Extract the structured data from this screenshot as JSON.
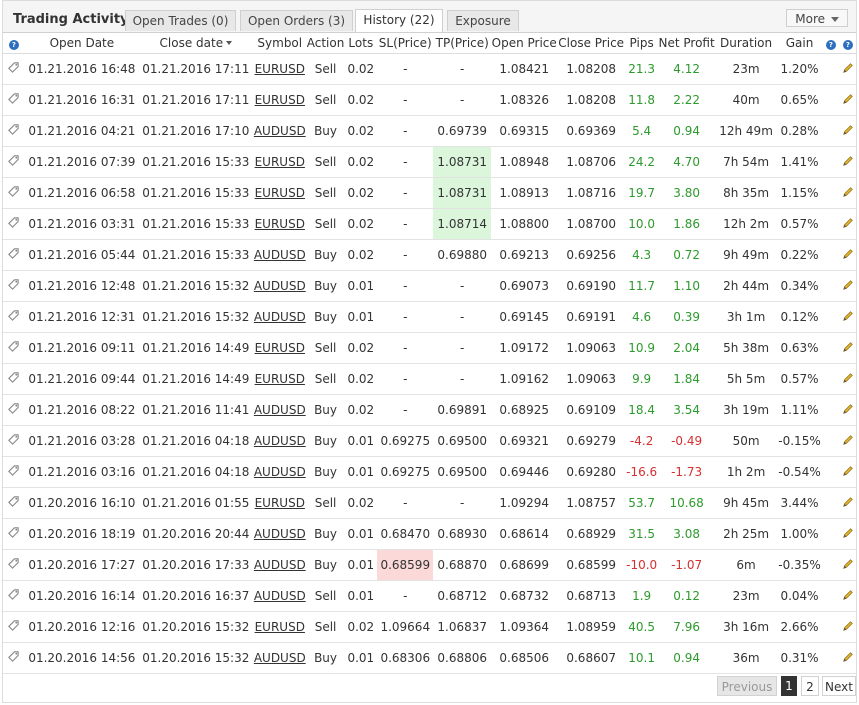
{
  "header": {
    "title": "Trading Activity",
    "tabs": [
      {
        "label": "Open Trades (0)"
      },
      {
        "label": "Open Orders (3)"
      },
      {
        "label": "History (22)"
      },
      {
        "label": "Exposure"
      }
    ],
    "more_label": "More"
  },
  "columns": [
    "Open Date",
    "Close date",
    "Symbol",
    "Action",
    "Lots",
    "SL(Price)",
    "TP(Price)",
    "Open Price",
    "Close Price",
    "Pips",
    "Net Profit",
    "Duration",
    "Gain"
  ],
  "colors": {
    "positive": "#2c9a2c",
    "negative": "#d63030",
    "tp_highlight": "#dcf6dc",
    "sl_highlight": "#fbd9d9",
    "help_icon": "#2d6fbf"
  },
  "rows": [
    {
      "open": "01.21.2016 16:48",
      "close": "01.21.2016 17:11",
      "symbol": "EURUSD",
      "action": "Sell",
      "lots": "0.02",
      "sl": "-",
      "tp": "-",
      "open_price": "1.08421",
      "close_price": "1.08208",
      "pips": "21.3",
      "profit": "4.12",
      "duration": "23m",
      "gain": "1.20%",
      "sign": "pos",
      "hl": ""
    },
    {
      "open": "01.21.2016 16:31",
      "close": "01.21.2016 17:11",
      "symbol": "EURUSD",
      "action": "Sell",
      "lots": "0.02",
      "sl": "-",
      "tp": "-",
      "open_price": "1.08326",
      "close_price": "1.08208",
      "pips": "11.8",
      "profit": "2.22",
      "duration": "40m",
      "gain": "0.65%",
      "sign": "pos",
      "hl": ""
    },
    {
      "open": "01.21.2016 04:21",
      "close": "01.21.2016 17:10",
      "symbol": "AUDUSD",
      "action": "Buy",
      "lots": "0.02",
      "sl": "-",
      "tp": "0.69739",
      "open_price": "0.69315",
      "close_price": "0.69369",
      "pips": "5.4",
      "profit": "0.94",
      "duration": "12h 49m",
      "gain": "0.28%",
      "sign": "pos",
      "hl": ""
    },
    {
      "open": "01.21.2016 07:39",
      "close": "01.21.2016 15:33",
      "symbol": "EURUSD",
      "action": "Sell",
      "lots": "0.02",
      "sl": "-",
      "tp": "1.08731",
      "open_price": "1.08948",
      "close_price": "1.08706",
      "pips": "24.2",
      "profit": "4.70",
      "duration": "7h 54m",
      "gain": "1.41%",
      "sign": "pos",
      "hl": "tp"
    },
    {
      "open": "01.21.2016 06:58",
      "close": "01.21.2016 15:33",
      "symbol": "EURUSD",
      "action": "Sell",
      "lots": "0.02",
      "sl": "-",
      "tp": "1.08731",
      "open_price": "1.08913",
      "close_price": "1.08716",
      "pips": "19.7",
      "profit": "3.80",
      "duration": "8h 35m",
      "gain": "1.15%",
      "sign": "pos",
      "hl": "tp"
    },
    {
      "open": "01.21.2016 03:31",
      "close": "01.21.2016 15:33",
      "symbol": "EURUSD",
      "action": "Sell",
      "lots": "0.02",
      "sl": "-",
      "tp": "1.08714",
      "open_price": "1.08800",
      "close_price": "1.08700",
      "pips": "10.0",
      "profit": "1.86",
      "duration": "12h 2m",
      "gain": "0.57%",
      "sign": "pos",
      "hl": "tp"
    },
    {
      "open": "01.21.2016 05:44",
      "close": "01.21.2016 15:33",
      "symbol": "AUDUSD",
      "action": "Buy",
      "lots": "0.02",
      "sl": "-",
      "tp": "0.69880",
      "open_price": "0.69213",
      "close_price": "0.69256",
      "pips": "4.3",
      "profit": "0.72",
      "duration": "9h 49m",
      "gain": "0.22%",
      "sign": "pos",
      "hl": ""
    },
    {
      "open": "01.21.2016 12:48",
      "close": "01.21.2016 15:32",
      "symbol": "AUDUSD",
      "action": "Buy",
      "lots": "0.01",
      "sl": "-",
      "tp": "-",
      "open_price": "0.69073",
      "close_price": "0.69190",
      "pips": "11.7",
      "profit": "1.10",
      "duration": "2h 44m",
      "gain": "0.34%",
      "sign": "pos",
      "hl": ""
    },
    {
      "open": "01.21.2016 12:31",
      "close": "01.21.2016 15:32",
      "symbol": "AUDUSD",
      "action": "Buy",
      "lots": "0.01",
      "sl": "-",
      "tp": "-",
      "open_price": "0.69145",
      "close_price": "0.69191",
      "pips": "4.6",
      "profit": "0.39",
      "duration": "3h 1m",
      "gain": "0.12%",
      "sign": "pos",
      "hl": ""
    },
    {
      "open": "01.21.2016 09:11",
      "close": "01.21.2016 14:49",
      "symbol": "EURUSD",
      "action": "Sell",
      "lots": "0.02",
      "sl": "-",
      "tp": "-",
      "open_price": "1.09172",
      "close_price": "1.09063",
      "pips": "10.9",
      "profit": "2.04",
      "duration": "5h 38m",
      "gain": "0.63%",
      "sign": "pos",
      "hl": ""
    },
    {
      "open": "01.21.2016 09:44",
      "close": "01.21.2016 14:49",
      "symbol": "EURUSD",
      "action": "Sell",
      "lots": "0.02",
      "sl": "-",
      "tp": "-",
      "open_price": "1.09162",
      "close_price": "1.09063",
      "pips": "9.9",
      "profit": "1.84",
      "duration": "5h 5m",
      "gain": "0.57%",
      "sign": "pos",
      "hl": ""
    },
    {
      "open": "01.21.2016 08:22",
      "close": "01.21.2016 11:41",
      "symbol": "AUDUSD",
      "action": "Buy",
      "lots": "0.02",
      "sl": "-",
      "tp": "0.69891",
      "open_price": "0.68925",
      "close_price": "0.69109",
      "pips": "18.4",
      "profit": "3.54",
      "duration": "3h 19m",
      "gain": "1.11%",
      "sign": "pos",
      "hl": ""
    },
    {
      "open": "01.21.2016 03:28",
      "close": "01.21.2016 04:18",
      "symbol": "AUDUSD",
      "action": "Buy",
      "lots": "0.01",
      "sl": "0.69275",
      "tp": "0.69500",
      "open_price": "0.69321",
      "close_price": "0.69279",
      "pips": "-4.2",
      "profit": "-0.49",
      "duration": "50m",
      "gain": "-0.15%",
      "sign": "neg",
      "hl": ""
    },
    {
      "open": "01.21.2016 03:16",
      "close": "01.21.2016 04:18",
      "symbol": "AUDUSD",
      "action": "Buy",
      "lots": "0.01",
      "sl": "0.69275",
      "tp": "0.69500",
      "open_price": "0.69446",
      "close_price": "0.69280",
      "pips": "-16.6",
      "profit": "-1.73",
      "duration": "1h 2m",
      "gain": "-0.54%",
      "sign": "neg",
      "hl": ""
    },
    {
      "open": "01.20.2016 16:10",
      "close": "01.21.2016 01:55",
      "symbol": "EURUSD",
      "action": "Sell",
      "lots": "0.02",
      "sl": "-",
      "tp": "-",
      "open_price": "1.09294",
      "close_price": "1.08757",
      "pips": "53.7",
      "profit": "10.68",
      "duration": "9h 45m",
      "gain": "3.44%",
      "sign": "pos",
      "hl": ""
    },
    {
      "open": "01.20.2016 18:19",
      "close": "01.20.2016 20:44",
      "symbol": "AUDUSD",
      "action": "Buy",
      "lots": "0.01",
      "sl": "0.68470",
      "tp": "0.68930",
      "open_price": "0.68614",
      "close_price": "0.68929",
      "pips": "31.5",
      "profit": "3.08",
      "duration": "2h 25m",
      "gain": "1.00%",
      "sign": "pos",
      "hl": ""
    },
    {
      "open": "01.20.2016 17:27",
      "close": "01.20.2016 17:33",
      "symbol": "AUDUSD",
      "action": "Buy",
      "lots": "0.01",
      "sl": "0.68599",
      "tp": "0.68870",
      "open_price": "0.68699",
      "close_price": "0.68599",
      "pips": "-10.0",
      "profit": "-1.07",
      "duration": "6m",
      "gain": "-0.35%",
      "sign": "neg",
      "hl": "sl"
    },
    {
      "open": "01.20.2016 16:14",
      "close": "01.20.2016 16:37",
      "symbol": "AUDUSD",
      "action": "Sell",
      "lots": "0.01",
      "sl": "-",
      "tp": "0.68712",
      "open_price": "0.68732",
      "close_price": "0.68713",
      "pips": "1.9",
      "profit": "0.12",
      "duration": "23m",
      "gain": "0.04%",
      "sign": "pos",
      "hl": ""
    },
    {
      "open": "01.20.2016 12:16",
      "close": "01.20.2016 15:32",
      "symbol": "EURUSD",
      "action": "Sell",
      "lots": "0.02",
      "sl": "1.09664",
      "tp": "1.06837",
      "open_price": "1.09364",
      "close_price": "1.08959",
      "pips": "40.5",
      "profit": "7.96",
      "duration": "3h 16m",
      "gain": "2.66%",
      "sign": "pos",
      "hl": ""
    },
    {
      "open": "01.20.2016 14:56",
      "close": "01.20.2016 15:32",
      "symbol": "AUDUSD",
      "action": "Buy",
      "lots": "0.01",
      "sl": "0.68306",
      "tp": "0.68806",
      "open_price": "0.68506",
      "close_price": "0.68607",
      "pips": "10.1",
      "profit": "0.94",
      "duration": "36m",
      "gain": "0.31%",
      "sign": "pos",
      "hl": ""
    }
  ],
  "pagination": {
    "previous": "Previous",
    "pages": [
      "1",
      "2"
    ],
    "current": "1",
    "next": "Next"
  }
}
